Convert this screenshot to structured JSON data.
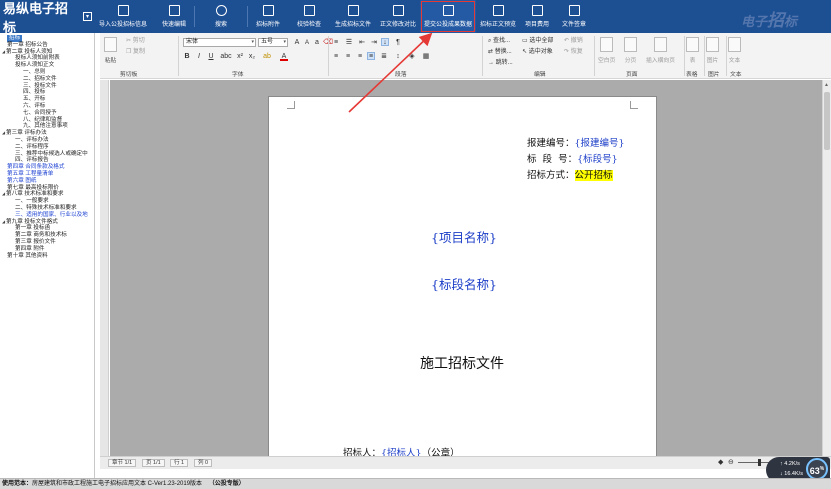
{
  "app": {
    "logo": "易纵电子招标",
    "watermark_a": "电子",
    "watermark_b": "招",
    "watermark_c": "标"
  },
  "toolbar": [
    {
      "label": "导入公投招标信息",
      "icon": "import-icon"
    },
    {
      "label": "快速编辑",
      "icon": "quick-edit-icon"
    },
    {
      "label": "搜索",
      "icon": "search-icon"
    },
    {
      "label": "招标附件",
      "icon": "attachment-icon"
    },
    {
      "label": "校验检查",
      "icon": "check-icon"
    },
    {
      "label": "生成招标文件",
      "icon": "generate-file-icon"
    },
    {
      "label": "正文修改对比",
      "icon": "compare-icon"
    },
    {
      "label": "提交公投成果数据",
      "icon": "submit-export-icon"
    },
    {
      "label": "招标正文预览",
      "icon": "preview-icon"
    },
    {
      "label": "项目费用",
      "icon": "fee-icon"
    },
    {
      "label": "文件签章",
      "icon": "sign-icon"
    }
  ],
  "tree": [
    {
      "label": "招标",
      "level": 0,
      "style": "selected"
    },
    {
      "label": "第一章 招标公告",
      "level": 0
    },
    {
      "label": "第二章 投标人须知",
      "level": 0,
      "caret": "open"
    },
    {
      "label": "投标人须知前附表",
      "level": 1
    },
    {
      "label": "投标人须知正文",
      "level": 1
    },
    {
      "label": "一、总则",
      "level": 2
    },
    {
      "label": "二、招标文件",
      "level": 2
    },
    {
      "label": "三、投标文件",
      "level": 2
    },
    {
      "label": "四、投标",
      "level": 2
    },
    {
      "label": "五、开标",
      "level": 2
    },
    {
      "label": "六、评标",
      "level": 2
    },
    {
      "label": "七、合同授予",
      "level": 2
    },
    {
      "label": "八、纪律和监督",
      "level": 2
    },
    {
      "label": "九、其他注意事项",
      "level": 2
    },
    {
      "label": "第三章 评标办法",
      "level": 0,
      "caret": "open"
    },
    {
      "label": "一、评标办法",
      "level": 1
    },
    {
      "label": "二、评标程序",
      "level": 1
    },
    {
      "label": "三、推荐中标候选人或确定中",
      "level": 1
    },
    {
      "label": "四、评标报告",
      "level": 1
    },
    {
      "label": "第四章 合同条款及格式",
      "level": 0,
      "style": "blue"
    },
    {
      "label": "第五章 工程量清单",
      "level": 0,
      "style": "blue"
    },
    {
      "label": "第六章 图纸",
      "level": 0,
      "style": "blue"
    },
    {
      "label": "第七章 最高投标限价",
      "level": 0
    },
    {
      "label": "第八章 技术标准和要求",
      "level": 0,
      "caret": "open"
    },
    {
      "label": "一、一般要求",
      "level": 1
    },
    {
      "label": "二、特殊技术标准和要求",
      "level": 1
    },
    {
      "label": "三、适用的国家、行业以及地",
      "level": 1,
      "style": "blue"
    },
    {
      "label": "第九章 投标文件格式",
      "level": 0,
      "caret": "open"
    },
    {
      "label": "第一章 投标函",
      "level": 1
    },
    {
      "label": "第二章 商务和技术标",
      "level": 1
    },
    {
      "label": "第三章 报价文件",
      "level": 1
    },
    {
      "label": "第四章 附件",
      "level": 1
    },
    {
      "label": "第十章 其他资料",
      "level": 0
    }
  ],
  "ribbon": {
    "clipboard": {
      "group": "剪切板",
      "paste": "粘贴",
      "cut": "剪切",
      "copy": "复制"
    },
    "font": {
      "group": "字体",
      "family": "宋体",
      "size": "五号"
    },
    "paragraph": {
      "group": "段落"
    },
    "edit": {
      "group": "编辑",
      "find": "查找...",
      "replace": "替换...",
      "jump": "跳转...",
      "select_all": "选中全部",
      "select_object": "选中对象",
      "undo": "撤销",
      "redo": "恢复"
    },
    "page": {
      "group": "页面",
      "blank_page": "空白页",
      "page_break": "分页",
      "insert_section": "插入横向页"
    },
    "table": {
      "group": "表格",
      "table": "表"
    },
    "image": {
      "group": "图片",
      "image": "图片"
    },
    "text": {
      "group": "文本",
      "text": "文本"
    },
    "icons": [
      "font-grow-icon",
      "font-shrink-icon",
      "change-case-icon",
      "clear-format-icon",
      "format-painter-icon",
      "bold-icon",
      "italic-icon",
      "underline-icon",
      "strikethrough-icon",
      "superscript-icon",
      "subscript-icon",
      "highlight-icon",
      "font-color-icon",
      "bullets-icon",
      "numbering-icon",
      "decrease-indent-icon",
      "increase-indent-icon",
      "sort-icon",
      "show-marks-icon",
      "align-left-icon",
      "align-center-icon",
      "align-right-icon",
      "justify-icon",
      "distributed-icon",
      "line-spacing-icon",
      "shading-icon",
      "borders-icon"
    ]
  },
  "document": {
    "report_no_label": "报建编号：",
    "report_no_value": "{报建编号}",
    "section_label": "标  段  号：",
    "section_value": "{标段号}",
    "method_label": "招标方式：",
    "method_value": "公开招标",
    "project_name": "{项目名称}",
    "section_name": "{标段名称}",
    "doc_title": "施工招标文件",
    "tenderer_label": "招标人：",
    "tenderer_value": "{招标人}",
    "tenderer_suffix": "（公章）"
  },
  "doc_status": {
    "section": "章节 1/1",
    "page": "页 1/1",
    "line": "行 1",
    "column": "列 0"
  },
  "net": {
    "up": "4.2",
    "down": "16.4",
    "up_unit": "K/s",
    "down_unit": "K/s",
    "percent": "63",
    "percent_unit": "%"
  },
  "status_bar": {
    "prefix": "使用范本：",
    "template": "房屋建筑和市政工程施工电子招标应用文本 C-Ver1.23-2019版本",
    "edition": "（公投专版）"
  },
  "colors": {
    "top_bar": "#1d4f93",
    "field_blue": "#1c3ec8",
    "highlight": "#ffff00",
    "annotation_red": "#e53935"
  }
}
